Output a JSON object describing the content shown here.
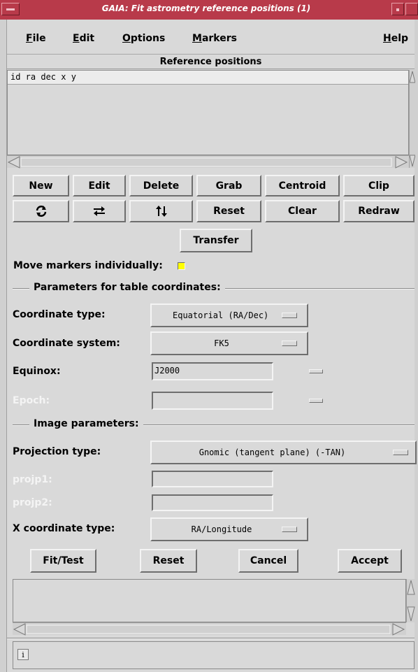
{
  "window": {
    "title": "GAIA: Fit astrometry reference positions (1)"
  },
  "menubar": {
    "file": {
      "prefix": "",
      "accel": "F",
      "rest": "ile"
    },
    "edit": {
      "prefix": "",
      "accel": "E",
      "rest": "dit"
    },
    "options": {
      "prefix": "",
      "accel": "O",
      "rest": "ptions"
    },
    "markers": {
      "prefix": "",
      "accel": "M",
      "rest": "arkers"
    },
    "help": {
      "prefix": "",
      "accel": "H",
      "rest": "elp"
    }
  },
  "reference_positions": {
    "header": "Reference positions",
    "columns_text": "id  ra  dec  x  y"
  },
  "buttons_row1": [
    "New",
    "Edit",
    "Delete",
    "Grab",
    "Centroid",
    "Clip"
  ],
  "buttons_row2": {
    "icon1": "rotate-icon",
    "icon2": "swap-horizontal-icon",
    "icon3": "swap-vertical-icon",
    "reset": "Reset",
    "clear": "Clear",
    "redraw": "Redraw"
  },
  "transfer_label": "Transfer",
  "move_markers_label": "Move markers individually:",
  "table_params": {
    "title": "Parameters for table coordinates:",
    "coord_type_label": "Coordinate type:",
    "coord_type_value": "Equatorial (RA/Dec)",
    "coord_system_label": "Coordinate system:",
    "coord_system_value": "FK5",
    "equinox_label": "Equinox:",
    "equinox_value": "J2000",
    "epoch_label": "Epoch:",
    "epoch_value": ""
  },
  "image_params": {
    "title": "Image parameters:",
    "projection_label": "Projection type:",
    "projection_value": "Gnomic (tangent plane) (-TAN)",
    "projp1_label": "projp1:",
    "projp1_value": "",
    "projp2_label": "projp2:",
    "projp2_value": "",
    "xcoord_label": "X coordinate type:",
    "xcoord_value": "RA/Longitude"
  },
  "actions": {
    "fit": "Fit/Test",
    "reset": "Reset",
    "cancel": "Cancel",
    "accept": "Accept"
  },
  "status": {
    "info_glyph": "i"
  },
  "colors": {
    "titlebar": "#b83a4a",
    "checkbox": "#ffff00",
    "background": "#d9d9d9"
  }
}
